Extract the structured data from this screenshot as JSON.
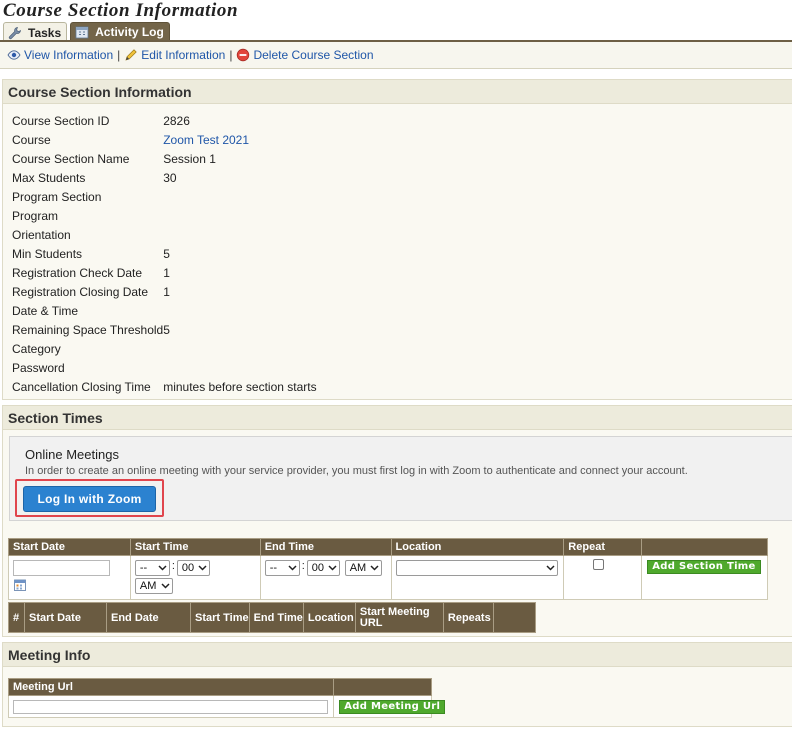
{
  "page": {
    "title": "Course Section Information"
  },
  "tabs": [
    {
      "label": "Tasks",
      "icon": "wrench-icon",
      "active": true
    },
    {
      "label": "Activity Log",
      "icon": "calendar-icon",
      "active": false
    }
  ],
  "toolbar": {
    "view": "View Information",
    "edit": "Edit Information",
    "delete": "Delete Course Section",
    "separator": "|"
  },
  "info_panel": {
    "title": "Course Section Information",
    "rows": [
      {
        "label": "Course Section ID",
        "value": "2826"
      },
      {
        "label": "Course",
        "value": "Zoom Test 2021",
        "link": true
      },
      {
        "label": "Course Section Name",
        "value": "Session 1"
      },
      {
        "label": "Max Students",
        "value": "30"
      },
      {
        "label": "Program Section",
        "value": ""
      },
      {
        "label": "Program",
        "value": ""
      },
      {
        "label": "Orientation",
        "value": ""
      },
      {
        "label": "Min Students",
        "value": "5"
      },
      {
        "label": "Registration Check Date",
        "value": "1"
      },
      {
        "label": "Registration Closing Date",
        "value": "1"
      },
      {
        "label": "Date & Time",
        "value": ""
      },
      {
        "label": "Remaining Space Threshold",
        "value": "5"
      },
      {
        "label": "Category",
        "value": ""
      },
      {
        "label": "Password",
        "value": ""
      },
      {
        "label": "Cancellation Closing Time",
        "value": "minutes before section starts"
      }
    ]
  },
  "section_times": {
    "title": "Section Times",
    "online_meetings": {
      "title": "Online Meetings",
      "description": "In order to create an online meeting with your service provider, you must first log in with Zoom to authenticate and connect your account.",
      "login_button": "Log In with Zoom"
    },
    "form": {
      "headers": [
        "Start Date",
        "Start Time",
        "End Time",
        "Location",
        "Repeat",
        ""
      ],
      "start_date_value": "",
      "start_hour": "--",
      "start_minute": "00",
      "start_ampm": "AM",
      "end_hour": "--",
      "end_minute": "00",
      "end_ampm": "AM",
      "location": "",
      "time_colon": ":",
      "add_button": "Add Section Time"
    },
    "list_headers": [
      "#",
      "Start Date",
      "End Date",
      "Start Time",
      "End Time",
      "Location",
      "Start Meeting URL",
      "Repeats",
      ""
    ]
  },
  "meeting_info": {
    "title": "Meeting Info",
    "headers": [
      "Meeting Url",
      ""
    ],
    "url_value": "",
    "add_button": "Add Meeting Url"
  },
  "colors": {
    "header_bg": "#6a5b41",
    "panel_head": "#edebdc",
    "link": "#1f56a8",
    "zoom_button": "#2b82d0",
    "highlight": "#e0454d",
    "green_button": "#4fa92d"
  }
}
